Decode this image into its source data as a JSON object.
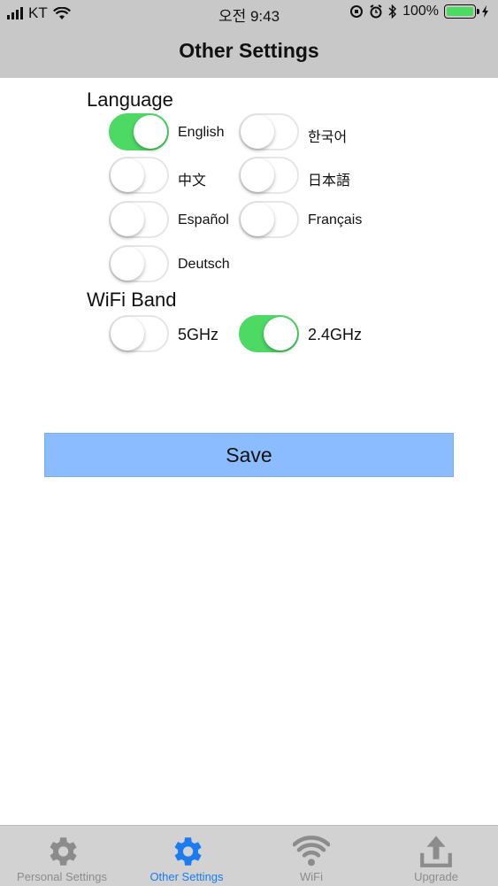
{
  "status_bar": {
    "carrier": "KT",
    "time": "오전 9:43",
    "battery_percent": "100%",
    "battery_level": 1.0,
    "battery_color": "#4cd964"
  },
  "header": {
    "title": "Other Settings"
  },
  "language": {
    "label": "Language",
    "options": [
      {
        "label": "English",
        "on": true
      },
      {
        "label": "한국어",
        "on": false
      },
      {
        "label": "中文",
        "on": false
      },
      {
        "label": "日本語",
        "on": false
      },
      {
        "label": "Español",
        "on": false
      },
      {
        "label": "Français",
        "on": false
      },
      {
        "label": "Deutsch",
        "on": false
      }
    ]
  },
  "wifi_band": {
    "label": "WiFi Band",
    "options": [
      {
        "label": "5GHz",
        "on": false
      },
      {
        "label": "2.4GHz",
        "on": true
      }
    ]
  },
  "save_label": "Save",
  "colors": {
    "toggle_on": "#4cd964",
    "save_button": "#8bbcff",
    "active_tab": "#1a7cf0",
    "inactive_tab": "#8c8c8c"
  },
  "tabs": [
    {
      "label": "Personal Settings",
      "icon": "gear-icon",
      "active": false
    },
    {
      "label": "Other Settings",
      "icon": "gear-icon",
      "active": true
    },
    {
      "label": "WiFi",
      "icon": "wifi-icon",
      "active": false
    },
    {
      "label": "Upgrade",
      "icon": "upload-icon",
      "active": false
    }
  ]
}
